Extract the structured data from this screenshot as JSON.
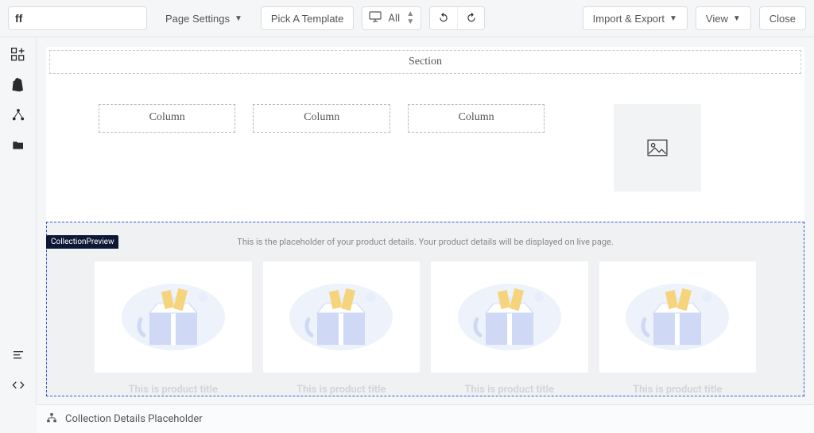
{
  "toolbar": {
    "page_title": "ff",
    "page_settings": "Page Settings",
    "pick_template": "Pick A Template",
    "device_label": "All",
    "import_export": "Import & Export",
    "view": "View",
    "close": "Close"
  },
  "canvas": {
    "section_label": "Section",
    "columns": [
      "Column",
      "Column",
      "Column"
    ],
    "preview_tag": "CollectionPreview",
    "preview_notice": "This is the placeholder of your product details. Your product details will be displayed on live page.",
    "product_title": "This is product title"
  },
  "breadcrumb": {
    "label": "Collection Details Placeholder"
  }
}
